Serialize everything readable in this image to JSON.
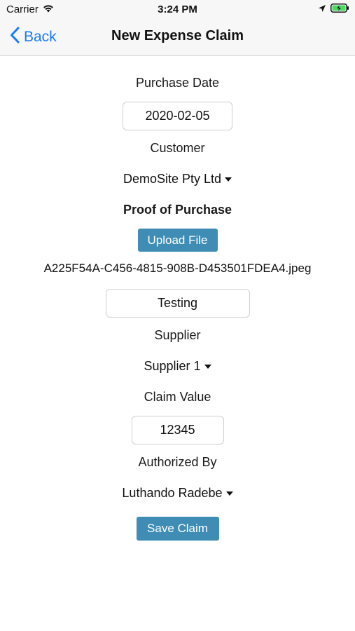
{
  "status_bar": {
    "carrier": "Carrier",
    "time": "3:24 PM",
    "icons": [
      "wifi-icon",
      "location-icon",
      "battery-charging-icon"
    ],
    "battery_color": "#4cd964"
  },
  "nav": {
    "back_label": "Back",
    "title": "New Expense Claim",
    "accent_color": "#1a7cf5"
  },
  "form": {
    "purchase_date_label": "Purchase Date",
    "purchase_date_value": "2020-02-05",
    "customer_label": "Customer",
    "customer_value": "DemoSite Pty Ltd",
    "proof_label": "Proof of Purchase",
    "upload_button": "Upload File",
    "file_name": "A225F54A-C456-4815-908B-D453501FDEA4.jpeg",
    "description_value": "Testing",
    "supplier_label": "Supplier",
    "supplier_value": "Supplier 1",
    "claim_value_label": "Claim Value",
    "claim_value": "12345",
    "authorized_by_label": "Authorized By",
    "authorized_by_value": "Luthando Radebe",
    "save_button": "Save Claim",
    "button_color": "#3f8db5"
  }
}
